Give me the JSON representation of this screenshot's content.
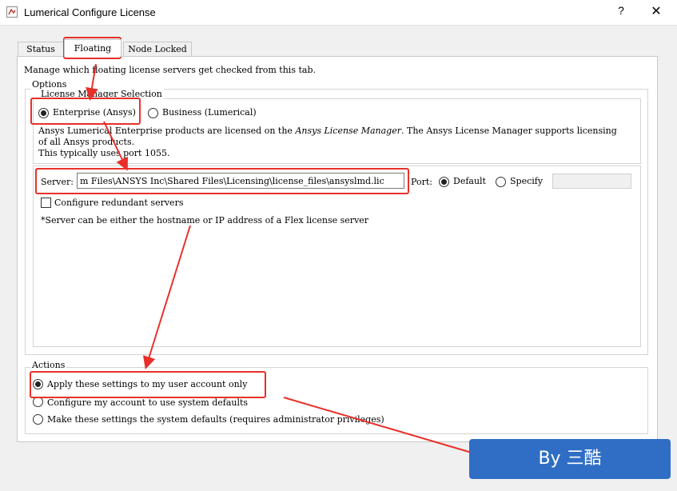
{
  "window": {
    "title": "Lumerical Configure License",
    "help_label": "?",
    "close_label": "✕"
  },
  "tabs": [
    {
      "label": "Status"
    },
    {
      "label": "Floating"
    },
    {
      "label": "Node Locked"
    }
  ],
  "floating": {
    "intro": "Manage which floating license servers get checked from this tab.",
    "options_legend": "Options",
    "lms": {
      "legend": "License Manager Selection",
      "enterprise_label": "Enterprise (Ansys)",
      "business_label": "Business (Lumerical)",
      "selected": "Enterprise (Ansys)",
      "desc_part1": "Ansys Lumerical Enterprise products are licensed on the ",
      "desc_em": "Ansys License Manager",
      "desc_part2": ". The Ansys License Manager supports licensing",
      "desc_line2": "of all Ansys products.",
      "desc_line3": "This typically uses port 1055."
    },
    "server": {
      "label": "Server:",
      "value": "m Files\\ANSYS Inc\\Shared Files\\Licensing\\license_files\\ansyslmd.lic",
      "port_label": "Port:",
      "default_label": "Default",
      "specify_label": "Specify",
      "port_selected": "Default",
      "port_value": "",
      "redundant_label": "Configure redundant servers",
      "redundant_checked": false,
      "note": "*Server can be either the hostname or IP address of a Flex license server"
    },
    "actions": {
      "legend": "Actions",
      "apply_label": "Apply these settings to my user account only",
      "config_label": "Configure my account to use system defaults",
      "make_label": "Make these settings the system defaults (requires administrator privileges)",
      "selected": "Apply these settings to my user account only"
    }
  },
  "watermark": "By 三酷",
  "colors": {
    "annotation": "#e8302a",
    "watermark_bg": "#2f6ec4",
    "window_bg": "#f0f0f0"
  }
}
